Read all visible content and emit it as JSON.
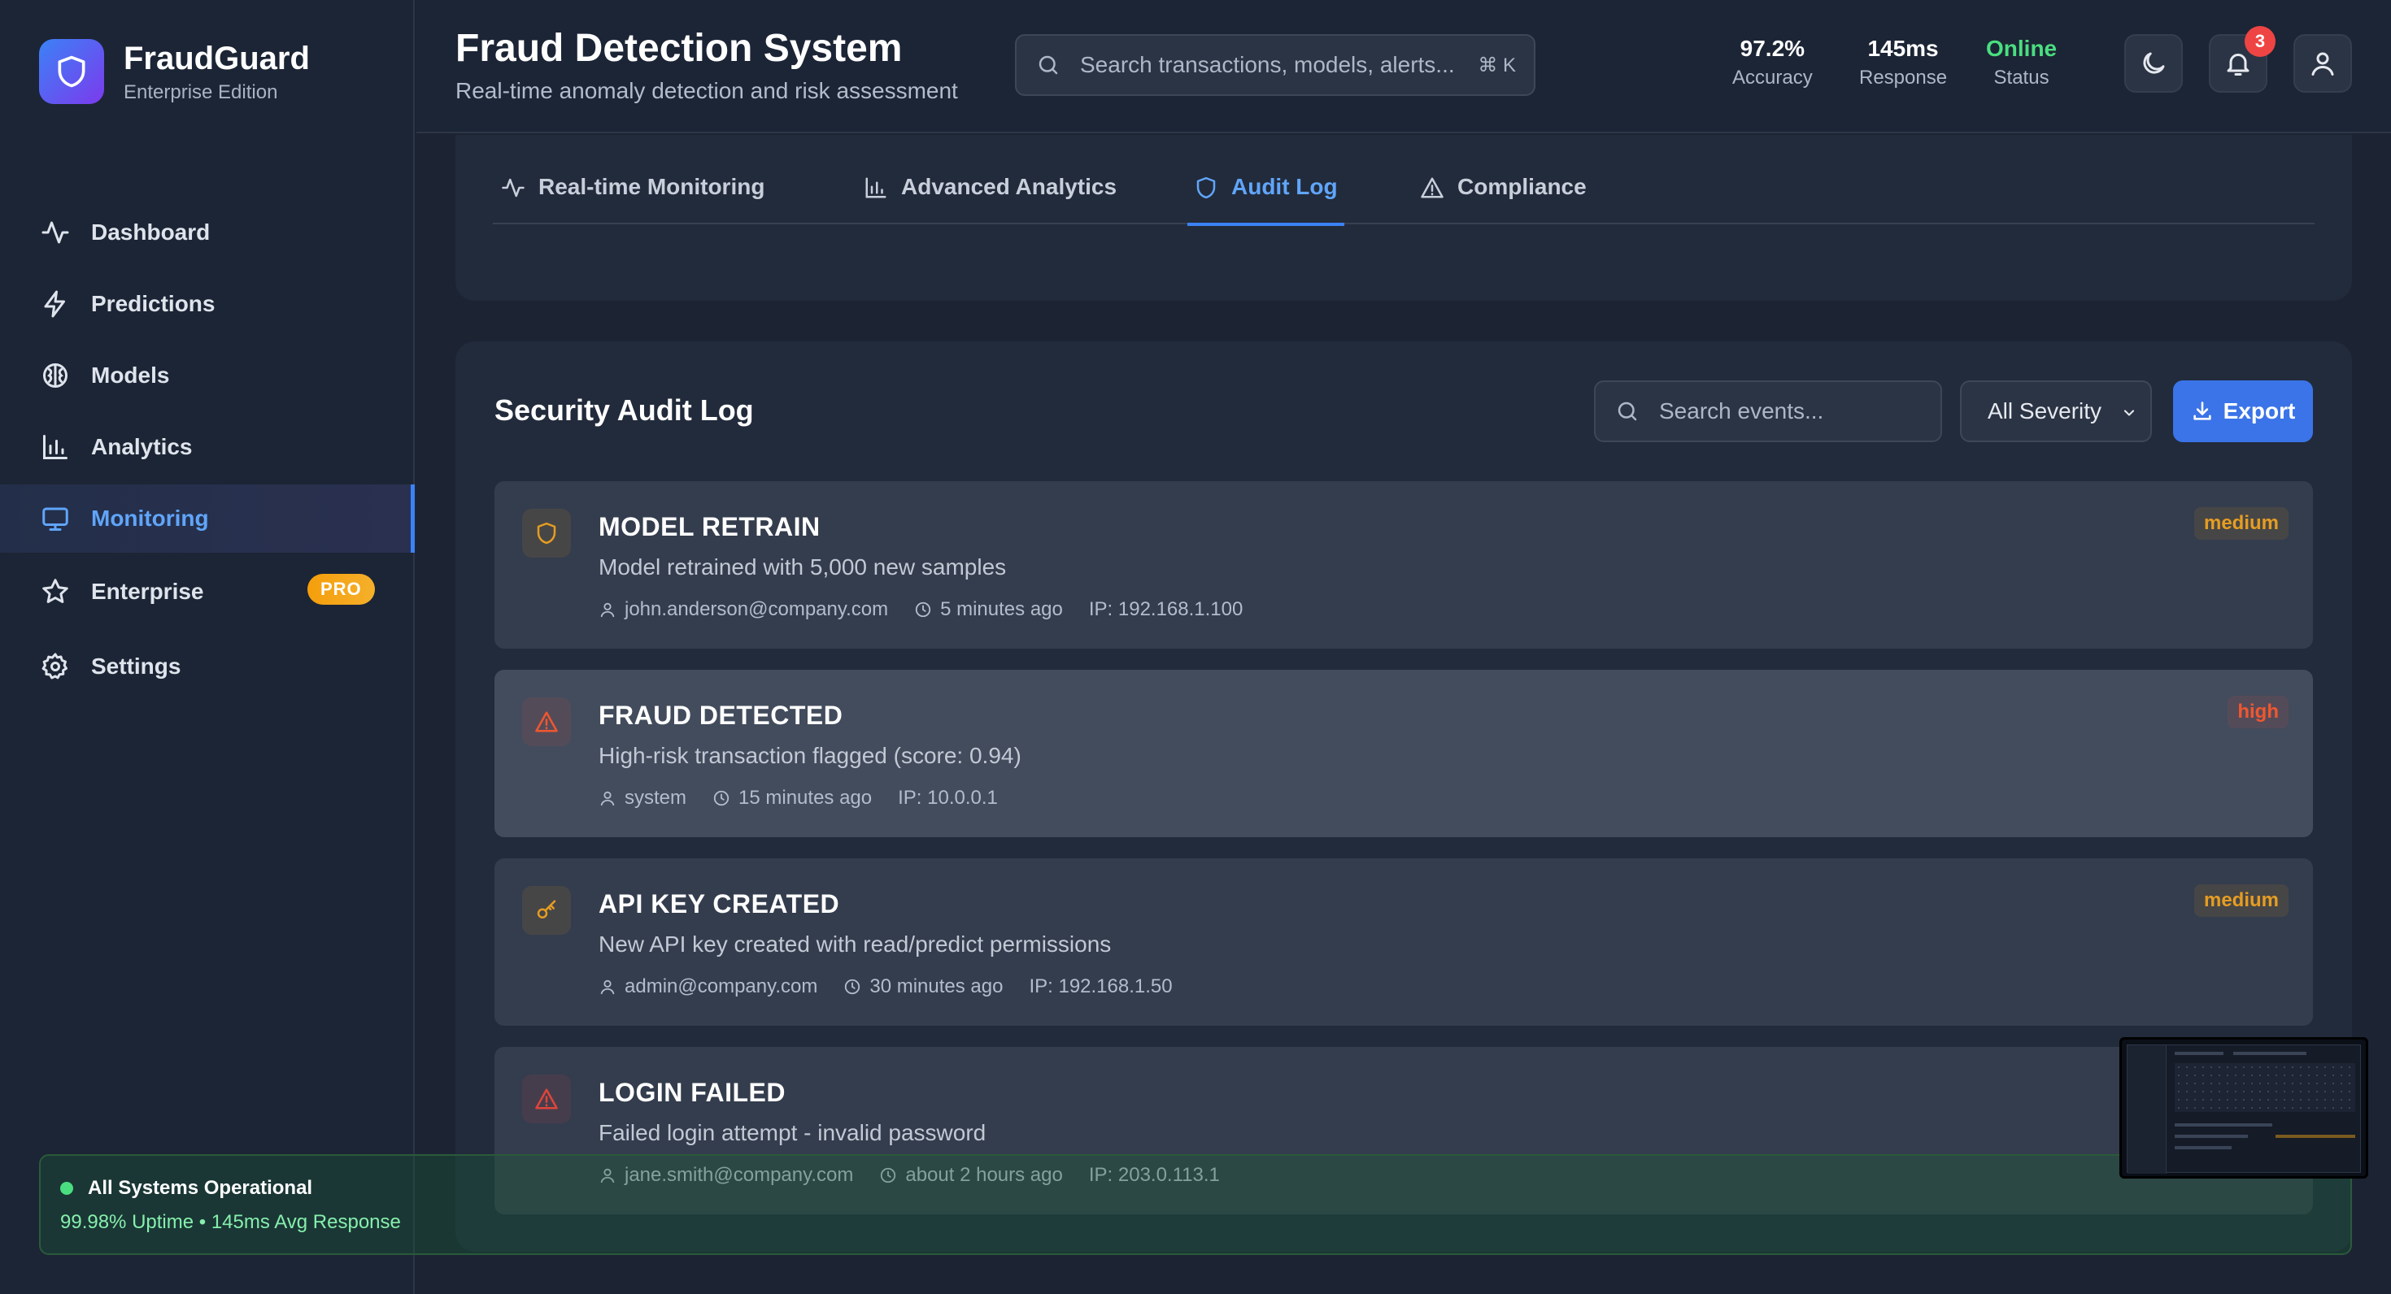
{
  "brand": {
    "name": "FraudGuard",
    "edition": "Enterprise Edition",
    "accent": "#3b82f6"
  },
  "sidebar": {
    "items": [
      {
        "label": "Dashboard",
        "icon": "activity-icon"
      },
      {
        "label": "Predictions",
        "icon": "zap-icon"
      },
      {
        "label": "Models",
        "icon": "brain-icon"
      },
      {
        "label": "Analytics",
        "icon": "bar-chart-icon"
      },
      {
        "label": "Monitoring",
        "icon": "monitor-icon",
        "active": true
      },
      {
        "label": "Enterprise",
        "icon": "star-icon",
        "badge": "PRO"
      },
      {
        "label": "Settings",
        "icon": "gear-icon"
      }
    ]
  },
  "header": {
    "title": "Fraud Detection System",
    "subtitle": "Real-time anomaly detection and risk assessment",
    "search_placeholder": "Search transactions, models, alerts...",
    "search_shortcut": "⌘ K",
    "stats": [
      {
        "value": "97.2%",
        "label": "Accuracy"
      },
      {
        "value": "145ms",
        "label": "Response"
      },
      {
        "value": "Online",
        "label": "Status",
        "color": "#4ade80"
      }
    ],
    "notification_count": "3"
  },
  "tabs": [
    {
      "label": "Real-time Monitoring",
      "icon": "activity-icon"
    },
    {
      "label": "Advanced Analytics",
      "icon": "bar-chart-icon"
    },
    {
      "label": "Audit Log",
      "icon": "shield-icon",
      "active": true
    },
    {
      "label": "Compliance",
      "icon": "warning-icon"
    }
  ],
  "audit": {
    "title": "Security Audit Log",
    "search_placeholder": "Search events...",
    "severity_filter": "All Severity",
    "export_label": "Export",
    "events": [
      {
        "title": "MODEL RETRAIN",
        "description": "Model retrained with 5,000 new samples",
        "user": "john.anderson@company.com",
        "time": "5 minutes ago",
        "ip": "IP: 192.168.1.100",
        "severity": "medium",
        "icon": "shield-icon"
      },
      {
        "title": "FRAUD DETECTED",
        "description": "High-risk transaction flagged (score: 0.94)",
        "user": "system",
        "time": "15 minutes ago",
        "ip": "IP: 10.0.0.1",
        "severity": "high",
        "icon": "warning-icon"
      },
      {
        "title": "API KEY CREATED",
        "description": "New API key created with read/predict permissions",
        "user": "admin@company.com",
        "time": "30 minutes ago",
        "ip": "IP: 192.168.1.50",
        "severity": "medium",
        "icon": "key-icon"
      },
      {
        "title": "LOGIN FAILED",
        "description": "Failed login attempt - invalid password",
        "user": "jane.smith@company.com",
        "time": "about 2 hours ago",
        "ip": "IP: 203.0.113.1",
        "severity": "",
        "icon": "warning-icon"
      }
    ]
  },
  "status": {
    "title": "All Systems Operational",
    "detail": "99.98% Uptime • 145ms Avg Response"
  },
  "colors": {
    "background": "#1c2433",
    "panel": "#222b3b",
    "medium": "#e59d22",
    "high": "#f0572f",
    "success": "#4ade80"
  }
}
